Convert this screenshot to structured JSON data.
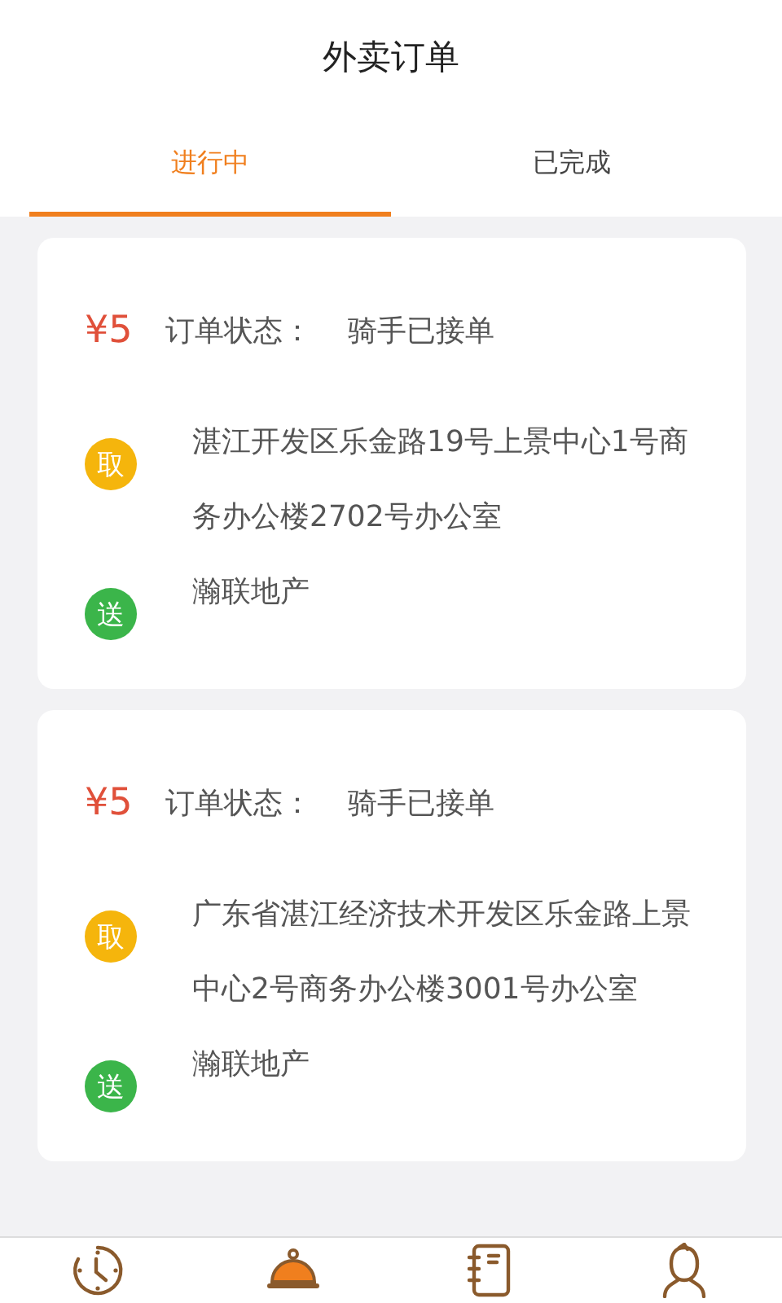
{
  "title": "外卖订单",
  "tabs": [
    {
      "label": "进行中",
      "selected": true
    },
    {
      "label": "已完成",
      "selected": false
    }
  ],
  "orders": [
    {
      "price": "¥5",
      "status_label": "订单状态：",
      "status": "骑手已接单",
      "stops": [
        {
          "badge": "取",
          "color": "#f5b50c",
          "address": "湛江开发区乐金路19号上景中心1号商务办公楼2702号办公室"
        },
        {
          "badge": "送",
          "color": "#3bb54a",
          "address": "瀚联地产"
        }
      ]
    },
    {
      "price": "¥5",
      "status_label": "订单状态：",
      "status": "骑手已接单",
      "stops": [
        {
          "badge": "取",
          "color": "#f5b50c",
          "address": "广东省湛江经济技术开发区乐金路上景中心2号商务办公楼3001号办公室"
        },
        {
          "badge": "送",
          "color": "#3bb54a",
          "address": "瀚联地产"
        }
      ]
    }
  ],
  "nav": [
    {
      "kind": "clock",
      "selected": false
    },
    {
      "kind": "cloche",
      "selected": true
    },
    {
      "kind": "notebook",
      "selected": false
    },
    {
      "kind": "person",
      "selected": false
    }
  ]
}
